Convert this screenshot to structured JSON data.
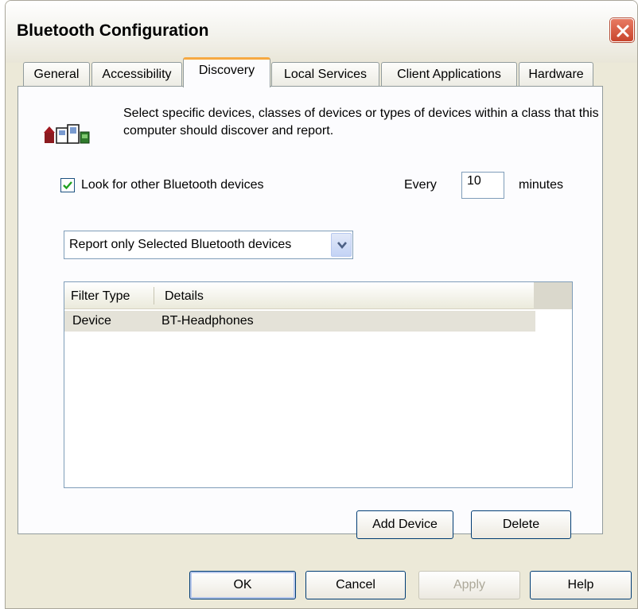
{
  "window": {
    "title": "Bluetooth Configuration"
  },
  "tabs": [
    {
      "label": "General"
    },
    {
      "label": "Accessibility"
    },
    {
      "label": "Discovery"
    },
    {
      "label": "Local Services"
    },
    {
      "label": "Client Applications"
    },
    {
      "label": "Hardware"
    }
  ],
  "active_tab": "Discovery",
  "discovery": {
    "description": "Select specific devices, classes of devices or types of devices within a class that this computer should discover and report.",
    "look_for_devices_label": "Look for other Bluetooth devices",
    "look_for_devices_checked": true,
    "every_label": "Every",
    "interval_value": "10",
    "minutes_label": "minutes",
    "report_select_value": "Report only Selected Bluetooth devices",
    "filter_list": {
      "columns": [
        "Filter Type",
        "Details"
      ],
      "rows": [
        {
          "filter_type": "Device",
          "details": "BT-Headphones"
        }
      ]
    },
    "add_device_label": "Add Device",
    "delete_label": "Delete"
  },
  "footer": {
    "ok_label": "OK",
    "cancel_label": "Cancel",
    "apply_label": "Apply",
    "apply_enabled": false,
    "help_label": "Help"
  },
  "colors": {
    "active_tab_accent": "#f6a942",
    "dialog_background": "#ece9d8",
    "close_button": "#c8452d"
  },
  "icons": {
    "close": "close-icon",
    "app": "computers-icon",
    "check": "checkmark-icon",
    "dropdown": "chevron-down-icon"
  }
}
